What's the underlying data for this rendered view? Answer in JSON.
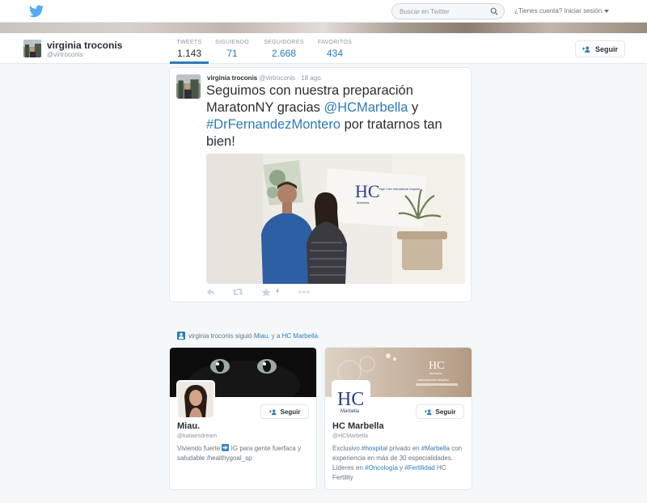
{
  "topbar": {
    "search_placeholder": "Buscar en Twitter",
    "login_text": "¿Tienes cuenta? Iniciar sesión"
  },
  "profile": {
    "name": "virginia troconis",
    "handle": "@virtroconis",
    "follow_label": "Seguir",
    "stats": [
      {
        "label": "TWEETS",
        "value": "1.143"
      },
      {
        "label": "SIGUIENDO",
        "value": "71"
      },
      {
        "label": "SEGUIDORES",
        "value": "2.668"
      },
      {
        "label": "FAVORITOS",
        "value": "434"
      }
    ]
  },
  "tweet": {
    "name": "virginia troconis",
    "handle": "@virtroconis",
    "sep": "·",
    "date": "18 ago.",
    "text_1": "Seguimos con nuestra preparación MaratonNY gracias ",
    "mention": "@HCMarbella",
    "text_2": " y ",
    "hashtag": "#DrFernandezMontero",
    "text_3": " por tratarnos tan bien!",
    "photo_logo": "HC",
    "photo_logo_sub": "Marbella",
    "photo_logo_side": "High Care International Hospital",
    "favorites": "4"
  },
  "notice": {
    "actor": "virginia troconis",
    "verb": " siguió ",
    "target1": "Miau.",
    "and": "  y a ",
    "target2": "HC Marbella"
  },
  "cards": [
    {
      "name": "Miau.",
      "handle": "@katiaesdream",
      "follow_label": "Seguir",
      "bio_1": "Viviendo fuerte ",
      "bio_2": " IG para gente fuerfaca y saludable /healthygoal_sp"
    },
    {
      "name": "HC Marbella",
      "handle": "@HCMarbella",
      "follow_label": "Seguir",
      "banner_logo": "HC",
      "banner_sub": "Marbella",
      "banner_side": "International Hospital",
      "avatar_logo": "HC",
      "avatar_sub": "Marbella",
      "bio_1": "Exclusivo ",
      "bio_tag1": "#hospital",
      "bio_2": " privado en ",
      "bio_tag2": "#Marbella",
      "bio_3": " con experiencia en más de 30 especialidades. Líderes en ",
      "bio_tag3": "#Oncología",
      "bio_4": " y ",
      "bio_tag4": "#Fertilidad",
      "bio_5": " HC Fertility"
    }
  ],
  "colors": {
    "accent": "#2b7bb9",
    "page_bg": "#f5f8fa",
    "border": "#e1e8ed"
  }
}
